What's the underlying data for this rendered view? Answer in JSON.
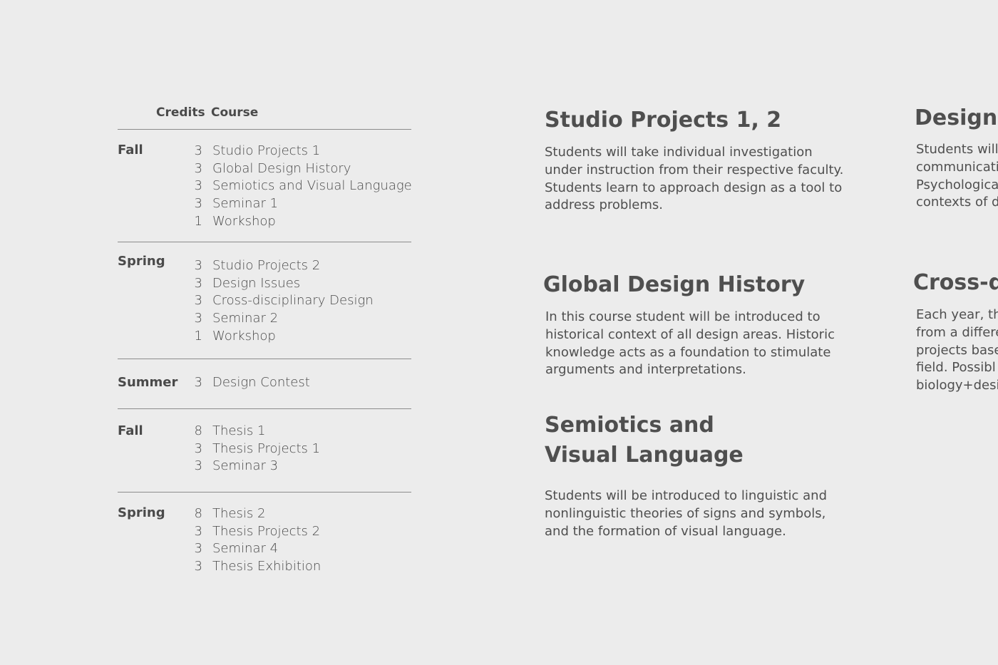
{
  "table": {
    "headers": {
      "credits": "Credits",
      "course": "Course"
    },
    "terms": [
      {
        "label": "Fall",
        "courses": [
          {
            "credits": "3",
            "name": "Studio Projects 1"
          },
          {
            "credits": "3",
            "name": "Global Design History"
          },
          {
            "credits": "3",
            "name": "Semiotics and Visual Language"
          },
          {
            "credits": "3",
            "name": "Seminar 1"
          },
          {
            "credits": "1",
            "name": "Workshop"
          }
        ]
      },
      {
        "label": "Spring",
        "courses": [
          {
            "credits": "3",
            "name": "Studio Projects 2"
          },
          {
            "credits": "3",
            "name": "Design Issues"
          },
          {
            "credits": "3",
            "name": "Cross-disciplinary Design"
          },
          {
            "credits": "3",
            "name": "Seminar 2"
          },
          {
            "credits": "1",
            "name": "Workshop"
          }
        ]
      },
      {
        "label": "Summer",
        "courses": [
          {
            "credits": "3",
            "name": "Design Contest"
          }
        ]
      },
      {
        "label": "Fall",
        "courses": [
          {
            "credits": "8",
            "name": "Thesis 1"
          },
          {
            "credits": "3",
            "name": "Thesis Projects 1"
          },
          {
            "credits": "3",
            "name": "Seminar 3"
          }
        ]
      },
      {
        "label": "Spring",
        "courses": [
          {
            "credits": "8",
            "name": "Thesis 2"
          },
          {
            "credits": "3",
            "name": "Thesis Projects 2"
          },
          {
            "credits": "3",
            "name": "Seminar 4"
          },
          {
            "credits": "3",
            "name": "Thesis Exhibition"
          }
        ]
      }
    ]
  },
  "descriptions": {
    "studio": {
      "title": "Studio Projects 1, 2",
      "body": "Students will take individual investigation\nunder instruction from their respective faculty.\nStudents learn to approach design as a tool to\naddress problems."
    },
    "history": {
      "title": "Global Design History",
      "body": "In this course student  will be introduced to\nhistorical context of all design areas. Historic\nknowledge acts as a foundation to stimulate\narguments and interpretations."
    },
    "semiotics": {
      "title": "Semiotics and\nVisual Language",
      "body": "Students will be introduced to linguistic and\nnonlinguistic theories of signs and symbols,\nand the formation of visual language."
    },
    "design_issues": {
      "title": "Design I",
      "body": "Students will\ncommunicatio\nPsychologica\ncontexts of d"
    },
    "cross": {
      "title": "Cross-di",
      "body": "Each year, th\nfrom a differe\nprojects base\nfield. Possibl\nbiology+desi"
    }
  }
}
